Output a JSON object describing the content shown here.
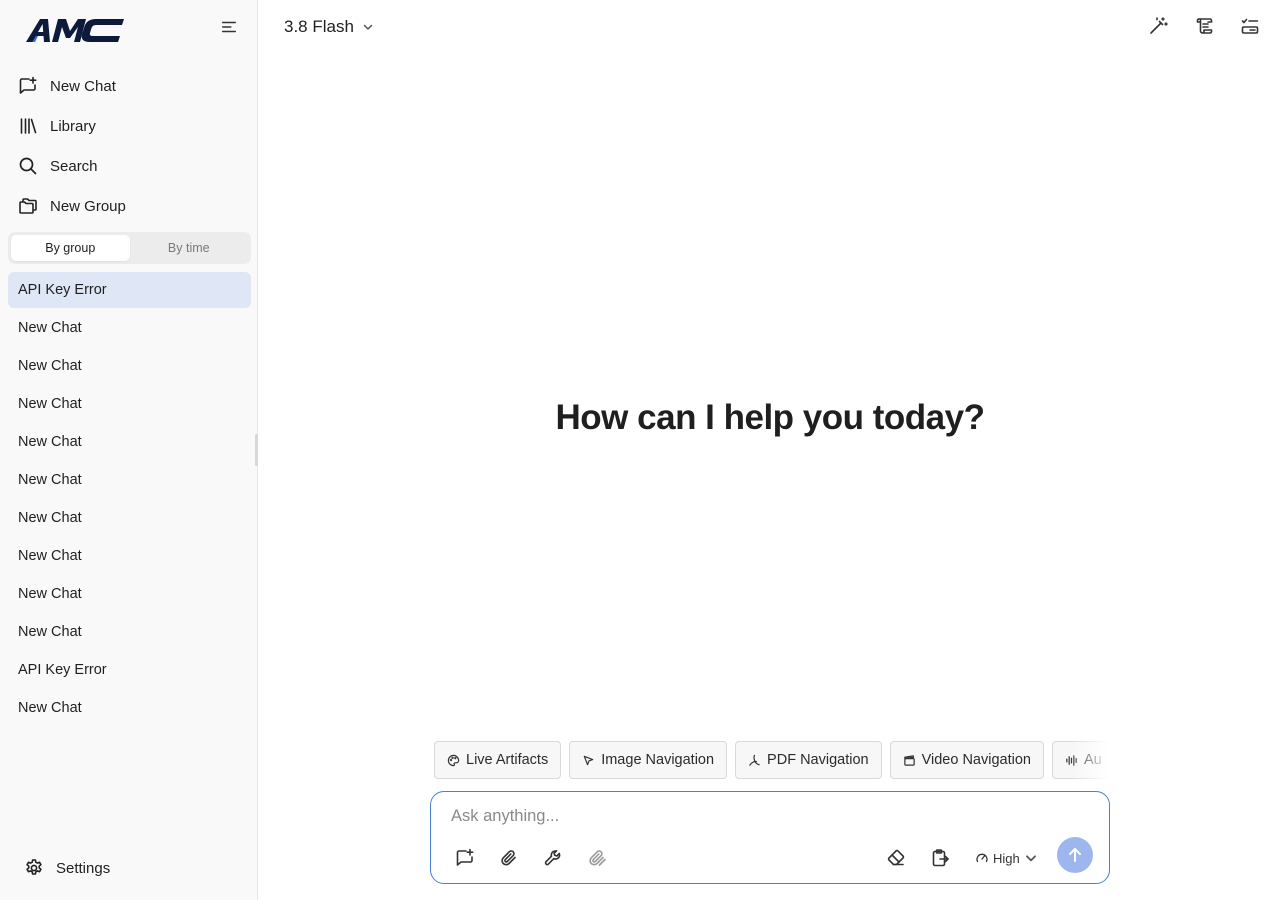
{
  "app": {
    "logo_text": "AMC"
  },
  "sidebar": {
    "nav": [
      {
        "label": "New Chat",
        "icon": "new-chat-icon"
      },
      {
        "label": "Library",
        "icon": "library-icon"
      },
      {
        "label": "Search",
        "icon": "search-icon"
      },
      {
        "label": "New Group",
        "icon": "folder-plus-icon"
      }
    ],
    "view_toggle": {
      "options": [
        "By group",
        "By time"
      ],
      "selected": "By group"
    },
    "chats": [
      {
        "title": "API Key Error",
        "active": true
      },
      {
        "title": "New Chat"
      },
      {
        "title": "New Chat"
      },
      {
        "title": "New Chat"
      },
      {
        "title": "New Chat"
      },
      {
        "title": "New Chat"
      },
      {
        "title": "New Chat"
      },
      {
        "title": "New Chat"
      },
      {
        "title": "New Chat"
      },
      {
        "title": "New Chat"
      },
      {
        "title": "API Key Error"
      },
      {
        "title": "New Chat"
      }
    ],
    "settings_label": "Settings"
  },
  "header": {
    "model": "3.8 Flash",
    "icons": [
      "magic-wand-icon",
      "scroll-icon",
      "checklist-icon"
    ]
  },
  "main": {
    "greeting": "How can I help you today?",
    "chips": [
      {
        "label": "Live Artifacts",
        "icon": "palette-icon"
      },
      {
        "label": "Image Navigation",
        "icon": "cursor-icon"
      },
      {
        "label": "PDF Navigation",
        "icon": "pdf-icon"
      },
      {
        "label": "Video Navigation",
        "icon": "clapperboard-icon"
      },
      {
        "label": "Au",
        "icon": "audio-wave-icon"
      }
    ]
  },
  "composer": {
    "placeholder": "Ask anything...",
    "effort": "High",
    "tools": [
      "new-message-icon",
      "paperclip-icon",
      "wrench-icon",
      "multi-attach-icon"
    ],
    "right_tools": [
      "eraser-icon",
      "clipboard-export-icon"
    ]
  },
  "colors": {
    "accent": "#4a7fd1",
    "send_button": "#9db7ee",
    "active_chat": "#dfe6f5",
    "sidebar_bg": "#f9f9f9"
  }
}
